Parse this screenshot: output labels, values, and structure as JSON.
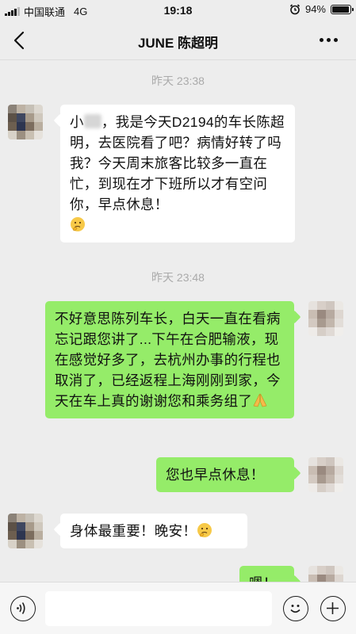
{
  "status_bar": {
    "carrier": "中国联通",
    "network": "4G",
    "time": "19:18",
    "battery_percent": "94%",
    "battery_level": 0.94
  },
  "nav": {
    "title": "JUNE 陈超明",
    "back_icon": "chevron-left-icon",
    "more_icon": "more-dots-icon"
  },
  "messages": [
    {
      "type": "time",
      "text": "昨天 23:38"
    },
    {
      "type": "in",
      "text_pre": "小",
      "text_post": "，我是今天D2194的车长陈超明，去医院看了吧？病情好转了吗我？今天周末旅客比较多一直在忙，到现在才下班所以才有空问你，早点休息！",
      "emoji": "thinking-face-emoji"
    },
    {
      "type": "time",
      "text": "昨天 23:48"
    },
    {
      "type": "out",
      "text": "不好意思陈列车长，白天一直在看病忘记跟您讲了...下午在合肥输液，现在感觉好多了，去杭州办事的行程也取消了，已经返程上海刚刚到家，今天在车上真的谢谢您和乘务组了",
      "emoji": "folded-hands-emoji"
    },
    {
      "type": "out",
      "text": "您也早点休息！"
    },
    {
      "type": "in",
      "text": "身体最重要！晚安！",
      "emoji": "thinking-face-emoji"
    },
    {
      "type": "out",
      "text": "嗯！"
    }
  ],
  "bottom_bar": {
    "voice_icon": "voice-icon",
    "emoji_icon": "emoji-smile-icon",
    "plus_icon": "plus-icon",
    "input_value": ""
  },
  "colors": {
    "background": "#ededed",
    "outgoing_bubble": "#95ec69",
    "incoming_bubble": "#ffffff"
  }
}
